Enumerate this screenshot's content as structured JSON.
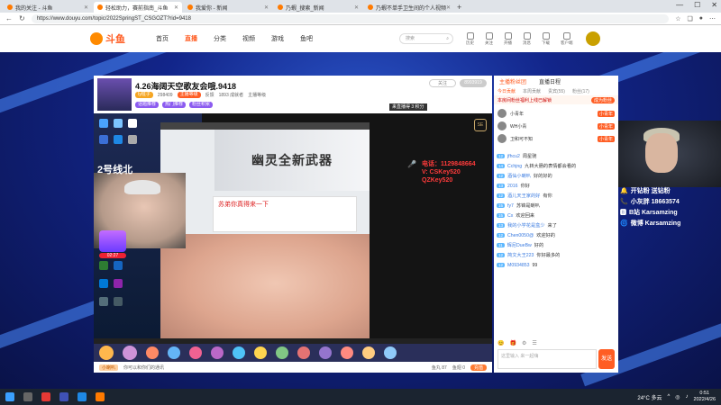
{
  "browser": {
    "tabs": [
      {
        "label": "我的关注 - 斗鱼",
        "active": false
      },
      {
        "label": "轻松助力，赛前指南_斗鱼 ",
        "active": true
      },
      {
        "label": "我爱你 - 新闻",
        "active": false
      },
      {
        "label": "乃蝦_搜索_新闻",
        "active": false
      },
      {
        "label": "乃蝦不单手卫生间的个人视频",
        "active": false
      }
    ],
    "new_tab": "+",
    "url": "https://www.douyu.com/topic/2022SpringST_CSGOZT?rid=9418",
    "controls": [
      "—",
      "☐",
      "✕"
    ]
  },
  "site": {
    "logo": "斗鱼",
    "nav": [
      "首页",
      "直播",
      "分类",
      "视频",
      "游戏",
      "鱼吧"
    ],
    "nav_active": "直播",
    "search_placeholder": "搜索",
    "user_icons": [
      "历史",
      "关注",
      "开播",
      "消息",
      "下载",
      "客户端"
    ]
  },
  "room": {
    "title": "4.26海阔天空歌友会哦.9418",
    "meta": [
      "Iy班子",
      "298409",
      "主播等级",
      "反馈",
      "1893 成就者",
      "主播等级"
    ],
    "tags": [
      "话题推荐",
      "热门推荐",
      "粉丝积累"
    ],
    "follow_label": "关注",
    "follow_count": "8993919",
    "share_label": "分享",
    "overlay_label": "来直播得 3 积分",
    "game_banner": "幽灵全新武器",
    "dialog_title": "苏弟你真得来一下",
    "big_number": "2号线北",
    "promo_time": "02:27",
    "contact": [
      "电话：1129848664",
      "V: CSKey520",
      "QZKey520"
    ],
    "se_logo": "SE",
    "bottom_tag": "小喇叭",
    "bottom_text": "你可以和你们的通讯",
    "bottom_stats": [
      "鱼丸 87",
      "鱼翅 0"
    ],
    "charge_label": "充值"
  },
  "chat": {
    "tabs": [
      "主播粉丝团",
      "直播日程"
    ],
    "active_tab": "主播粉丝团",
    "rank_tabs": [
      "今日贡献",
      "本周贡献",
      "贵宾(55)",
      "粉丝(17)"
    ],
    "notice": "本房间粉丝福利上线已解锁",
    "notice_btn": "成为粉丝",
    "fans": [
      {
        "name": "小青年",
        "level": "小青年"
      },
      {
        "name": "WH小青",
        "level": "小青年"
      },
      {
        "name": "卫和可不知",
        "level": "小青年"
      }
    ],
    "messages": [
      {
        "lv": "12",
        "name": "jfhcu2",
        "text": "周星驰"
      },
      {
        "lv": "14",
        "name": "Cchjng",
        "text": "九转大肠的表情都会看的"
      },
      {
        "lv": "12",
        "name": "酒仙小喇叭",
        "text": "好的好的"
      },
      {
        "lv": "13",
        "name": "2016",
        "text": "你好"
      },
      {
        "lv": "12",
        "name": "酒儿天王家的好",
        "text": "有你"
      },
      {
        "lv": "15",
        "name": "fy7",
        "text": "苏锦是喇叭"
      },
      {
        "lv": "15",
        "name": "Cx",
        "text": "欢迎回来"
      },
      {
        "lv": "13",
        "name": "我的小学花是盒少",
        "text": "来了"
      },
      {
        "lv": "12",
        "name": "Chen0050@",
        "text": "欢迎好的"
      },
      {
        "lv": "11",
        "name": "辉尼DueBw",
        "text": "好的"
      },
      {
        "lv": "12",
        "name": "简文大王223",
        "text": "你好最多的"
      },
      {
        "lv": "12",
        "name": "M0934853",
        "text": "99"
      }
    ],
    "tools": [
      "😊",
      "🎁",
      "⚙",
      "☰"
    ],
    "input_placeholder": "这里输入 来一起嗨",
    "send_label": "发送"
  },
  "promo": [
    {
      "icon": "🔔",
      "text": "开钻粉 送钻粉"
    },
    {
      "icon": "📞",
      "text": "小灰胖 18663574"
    },
    {
      "icon": "🅱",
      "text": "B站 Karsamzing"
    },
    {
      "icon": "🌀",
      "text": "微博 Karsamzing"
    }
  ],
  "taskbar": {
    "weather": "24°C 多云",
    "time": "0:51",
    "date": "2022/4/26"
  },
  "colors": {
    "accent": "#ff5d23",
    "page_bg": "#12258a",
    "taskbar": "#1b2430"
  }
}
